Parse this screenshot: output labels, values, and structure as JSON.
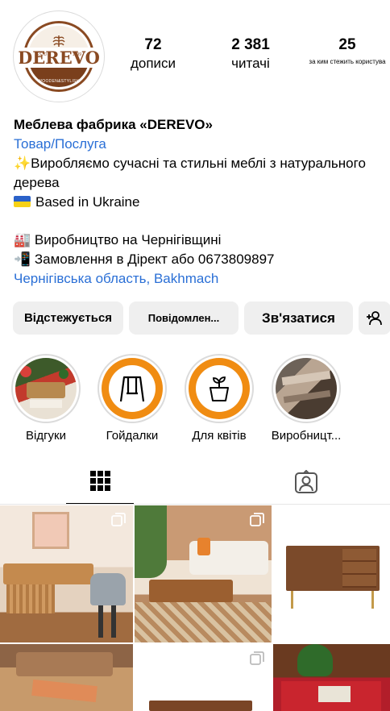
{
  "profile": {
    "logo": {
      "brand": "DEREVO",
      "est": "ESTD",
      "year": "1999",
      "tagline": "WOODEN&STYLISH"
    },
    "stats": [
      {
        "value": "72",
        "label": "дописи"
      },
      {
        "value": "2 381",
        "label": "читачі"
      },
      {
        "value": "25",
        "label": "за ким стежить користува"
      }
    ],
    "name": "Меблева фабрика «DEREVO»",
    "category": "Товар/Послуга",
    "bio_lines": [
      "✨Виробляємо сучасні та стильні меблі з натурального дерева",
      "Based in Ukraine",
      "",
      "🏭 Виробництво на Чернігівщині",
      "📲 Замовлення в Дірект або 0673809897"
    ],
    "location": "Чернігівська область, Bakhmach"
  },
  "actions": {
    "following": "Відстежується",
    "message": "Повідомлен...",
    "contact": "Зв'язатися",
    "add_user_icon": "add-person-icon"
  },
  "highlights": [
    {
      "label": "Відгуки",
      "icon": "reviews-photo"
    },
    {
      "label": "Гойдалки",
      "icon": "swing-icon"
    },
    {
      "label": "Для квітів",
      "icon": "flower-pot-icon"
    },
    {
      "label": "Виробницт...",
      "icon": "production-photo"
    }
  ],
  "tabs": [
    {
      "name": "grid",
      "icon": "grid-icon",
      "active": true
    },
    {
      "name": "tagged",
      "icon": "tagged-person-icon",
      "active": false
    }
  ],
  "colors": {
    "accent_link": "#2a6fd6",
    "button_bg": "#efefef",
    "highlight_orange": "#f08c12",
    "brand_brown": "#8a4a22"
  }
}
